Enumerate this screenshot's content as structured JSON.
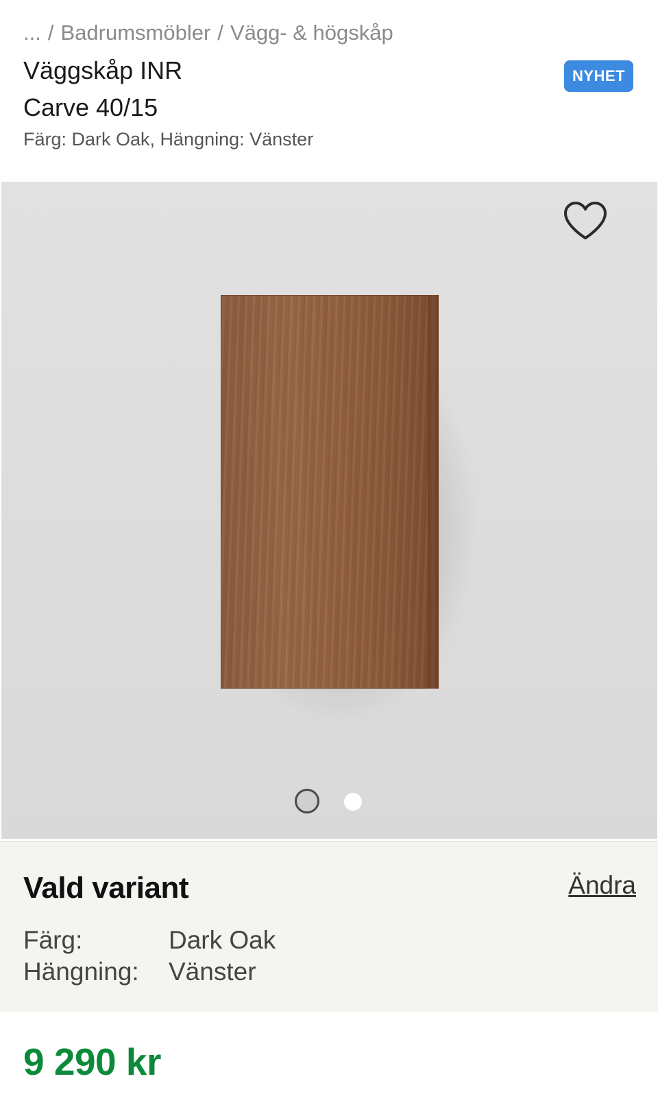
{
  "breadcrumb": {
    "items": [
      "...",
      "Badrumsmöbler",
      "Vägg- & högskåp"
    ],
    "separator": "/"
  },
  "product": {
    "title_line1": "Väggskåp INR",
    "title_line2": "Carve 40/15",
    "subtitle": "Färg: Dark Oak, Hängning: Vänster",
    "badge": "NYHET",
    "price": "9 290 kr"
  },
  "gallery": {
    "favorite_icon": "heart-outline-icon",
    "image_count": 2,
    "active_index": 0
  },
  "variant": {
    "title": "Vald variant",
    "change_label": "Ändra",
    "color_label": "Färg:",
    "color_value": "Dark Oak",
    "hanging_label": "Hängning:",
    "hanging_value": "Vänster"
  },
  "colors": {
    "badge_bg": "#3d8be0",
    "price": "#0b8a3a"
  }
}
